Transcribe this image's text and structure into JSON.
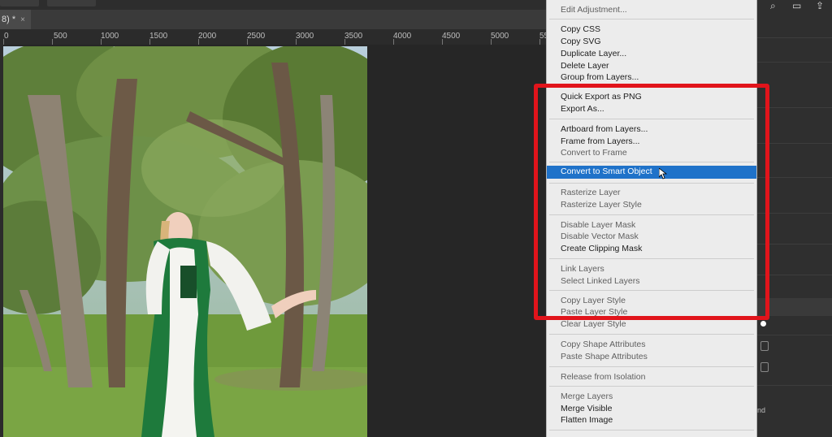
{
  "document_tab": {
    "title": "8) *",
    "close": "×"
  },
  "ruler": {
    "labels": [
      "0",
      "500",
      "1000",
      "1500",
      "2000",
      "2500",
      "3000",
      "3500",
      "4000",
      "4500",
      "5000",
      "55"
    ]
  },
  "context_menu": {
    "items": [
      {
        "label": "Edit Adjustment...",
        "dim": true
      },
      {
        "label": "Copy CSS"
      },
      {
        "label": "Copy SVG"
      },
      {
        "label": "Duplicate Layer..."
      },
      {
        "label": "Delete Layer"
      },
      {
        "label": "Group from Layers..."
      },
      {
        "label": "Quick Export as PNG"
      },
      {
        "label": "Export As..."
      },
      {
        "label": "Artboard from Layers..."
      },
      {
        "label": "Frame from Layers..."
      },
      {
        "label": "Convert to Frame",
        "dim": true
      },
      {
        "label": "Convert to Smart Object",
        "selected": true
      },
      {
        "label": "Rasterize Layer",
        "dim": true
      },
      {
        "label": "Rasterize Layer Style",
        "dim": true
      },
      {
        "label": "Disable Layer Mask",
        "dim": true
      },
      {
        "label": "Disable Vector Mask",
        "dim": true
      },
      {
        "label": "Create Clipping Mask"
      },
      {
        "label": "Link Layers",
        "dim": true
      },
      {
        "label": "Select Linked Layers",
        "dim": true
      },
      {
        "label": "Copy Layer Style",
        "dim": true
      },
      {
        "label": "Paste Layer Style",
        "dim": true
      },
      {
        "label": "Clear Layer Style",
        "dim": true
      },
      {
        "label": "Copy Shape Attributes",
        "dim": true
      },
      {
        "label": "Paste Shape Attributes",
        "dim": true
      },
      {
        "label": "Release from Isolation",
        "dim": true
      },
      {
        "label": "Merge Layers",
        "dim": true
      },
      {
        "label": "Merge Visible"
      },
      {
        "label": "Flatten Image"
      }
    ]
  },
  "right_panel": {
    "partial_text": "nd"
  },
  "colors": {
    "menu_bg": "#ececec",
    "selection": "#1f72c9",
    "annotation": "#e1141b"
  }
}
